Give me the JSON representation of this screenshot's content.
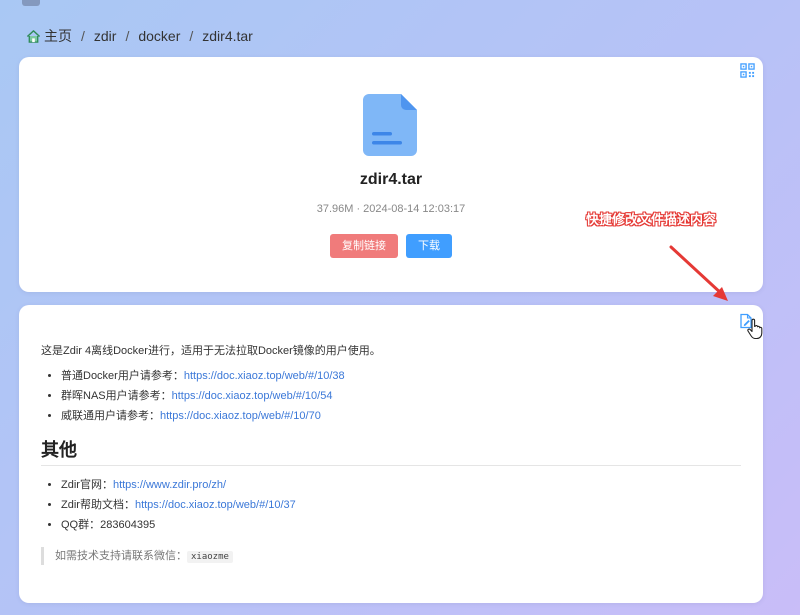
{
  "breadcrumb": {
    "items": [
      "主页",
      "zdir",
      "docker",
      "zdir4.tar"
    ],
    "separator": "/"
  },
  "file": {
    "name": "zdir4.tar",
    "size": "37.96M",
    "meta_separator": "·",
    "modified": "2024-08-14 12:03:17",
    "icon": "document-file-icon"
  },
  "buttons": {
    "copy_link": "复制链接",
    "download": "下载"
  },
  "annotation": {
    "text": "快捷修改文件描述内容"
  },
  "description": {
    "intro": "这是Zdir 4离线Docker进行，适用于无法拉取Docker镜像的用户使用。",
    "references": [
      {
        "label": "普通Docker用户请参考：",
        "link": "https://doc.xiaoz.top/web/#/10/38"
      },
      {
        "label": "群晖NAS用户请参考：",
        "link": "https://doc.xiaoz.top/web/#/10/54"
      },
      {
        "label": "威联通用户请参考：",
        "link": "https://doc.xiaoz.top/web/#/10/70"
      }
    ],
    "others_heading": "其他",
    "others": [
      {
        "label": "Zdir官网：",
        "link": "https://www.zdir.pro/zh/"
      },
      {
        "label": "Zdir帮助文档：",
        "link": "https://doc.xiaoz.top/web/#/10/37"
      },
      {
        "label": "QQ群：",
        "link": "",
        "value": "283604395"
      }
    ],
    "support_text": "如需技术支持请联系微信：",
    "support_wechat": "xiaozme"
  },
  "colors": {
    "accent": "#409eff",
    "danger": "#f07b7b",
    "annotation_red": "#e53935",
    "home_icon": "#3aa36b"
  }
}
